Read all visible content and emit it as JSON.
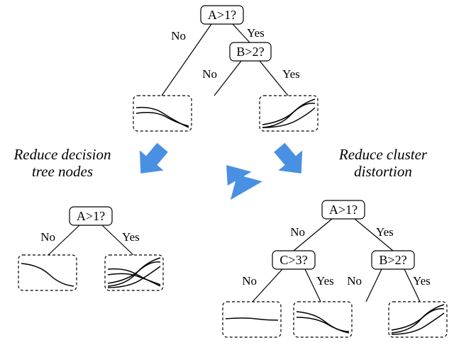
{
  "top_tree": {
    "root": {
      "label": "A>1?"
    },
    "root_no": "No",
    "root_yes": "Yes",
    "child": {
      "label": "B>2?"
    },
    "child_no": "No",
    "child_yes": "Yes"
  },
  "captions": {
    "left_line1": "Reduce decision",
    "left_line2": "tree nodes",
    "right_line1": "Reduce cluster",
    "right_line2": "distortion"
  },
  "left_tree": {
    "root": {
      "label": "A>1?"
    },
    "root_no": "No",
    "root_yes": "Yes"
  },
  "right_tree": {
    "root": {
      "label": "A>1?"
    },
    "root_no": "No",
    "root_yes": "Yes",
    "left_child": {
      "label": "C>3?"
    },
    "left_no": "No",
    "left_yes": "Yes",
    "right_child": {
      "label": "B>2?"
    },
    "right_no": "No",
    "right_yes": "Yes"
  }
}
